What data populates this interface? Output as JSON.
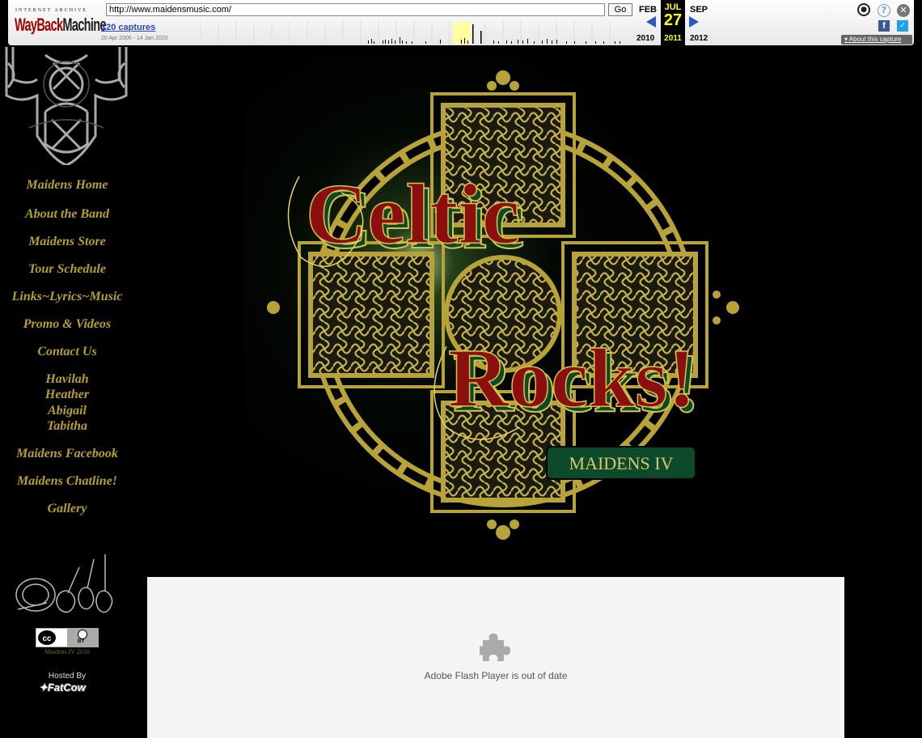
{
  "wayback": {
    "archive_label": "INTERNET ARCHIVE",
    "logo_text_a": "WayBack",
    "logo_text_b": "Machine",
    "url": "http://www.maidensmusic.com/",
    "go_label": "Go",
    "captures_label": "120 captures",
    "capture_range": "20 Apr 2006 - 14 Jan 2020",
    "prev_month": "FEB",
    "current_month": "JUL",
    "next_month": "SEP",
    "current_day": "27",
    "prev_year": "2010",
    "current_year": "2011",
    "next_year": "2012",
    "about_capture": "About this capture",
    "user_icon": "user-icon",
    "help_icon": "help-icon",
    "close_icon": "close-icon",
    "facebook_icon": "facebook-icon",
    "twitter_icon": "twitter-icon"
  },
  "sidebar": {
    "nav": [
      {
        "label": "Maidens Home"
      },
      {
        "label": "About the Band"
      },
      {
        "label": "Maidens Store"
      },
      {
        "label": "Tour Schedule"
      },
      {
        "label": "Links~Lyrics~Music"
      },
      {
        "label": "Promo & Videos"
      },
      {
        "label": "Contact Us"
      },
      {
        "label": "Havilah"
      },
      {
        "label": "Heather"
      },
      {
        "label": "Abigail"
      },
      {
        "label": "Tabitha"
      },
      {
        "label": "Maidens Facebook"
      },
      {
        "label": "Maidens Chatline!"
      },
      {
        "label": "Gallery"
      }
    ],
    "cc_label": "cc",
    "cc_by": "BY",
    "cc_caption": "Maidens IV 2010",
    "hosted_by": "Hosted By",
    "host_name": "FatCow"
  },
  "hero": {
    "title_line1": "Celtic",
    "title_line2": "Rocks!",
    "album_label": "MAIDENS IV"
  },
  "flash": {
    "message": "Adobe Flash Player is out of date",
    "icon": "puzzle-piece-icon"
  },
  "colors": {
    "link_gold": "#b5a12a",
    "title_red": "#8b0f0f",
    "knot_gold": "#b8a338",
    "badge_green": "#0d4a2c"
  }
}
